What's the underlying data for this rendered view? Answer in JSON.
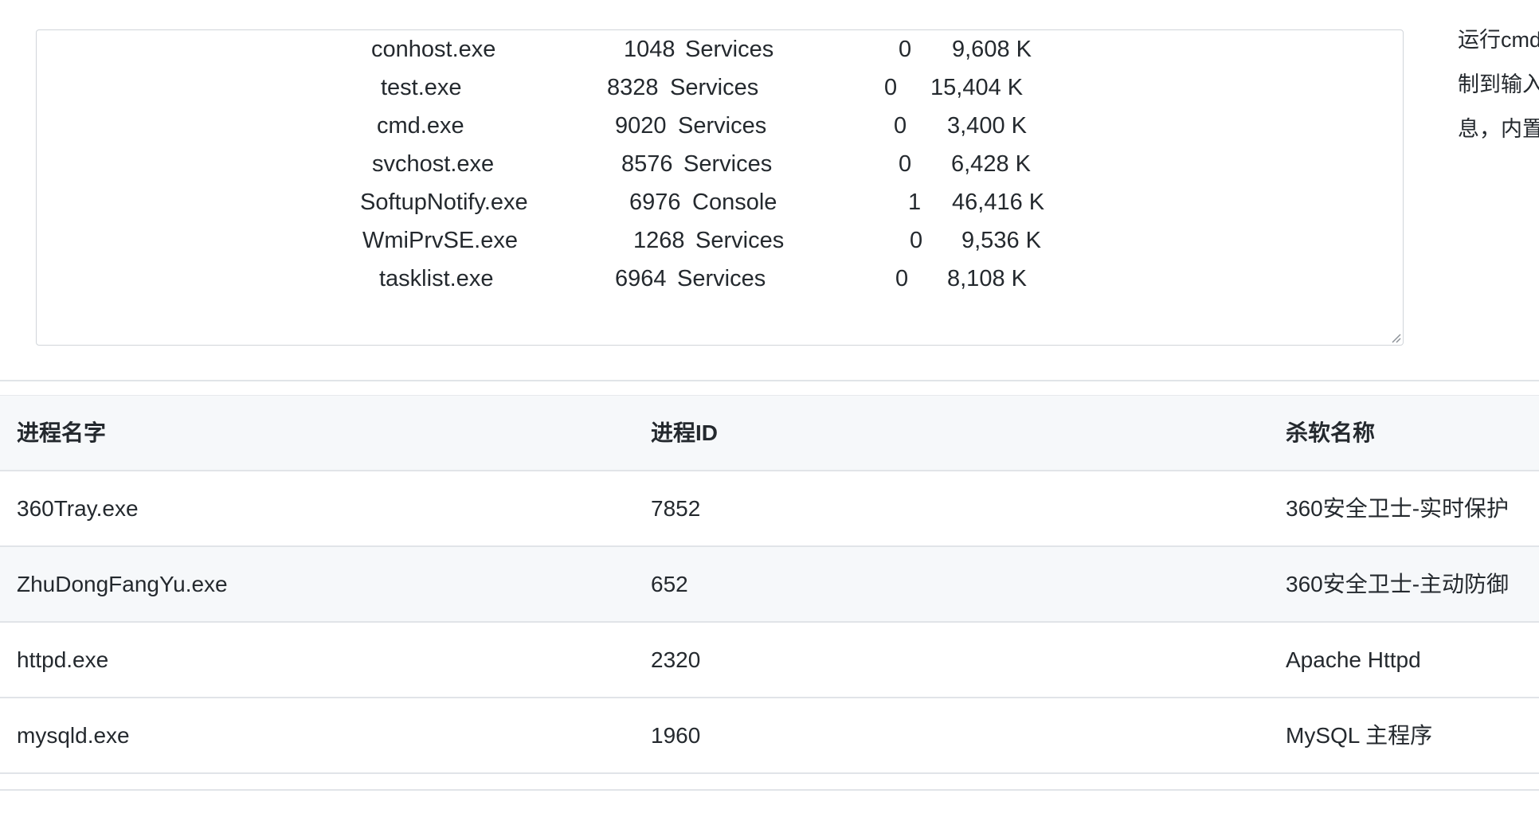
{
  "textarea": {
    "lines": [
      {
        "name": "conhost.exe",
        "pid": "1048",
        "session": "Services",
        "num": "0",
        "mem": "9,608 K"
      },
      {
        "name": "test.exe",
        "pid": "8328",
        "session": "Services",
        "num": "0",
        "mem": "15,404 K"
      },
      {
        "name": "cmd.exe",
        "pid": "9020",
        "session": "Services",
        "num": "0",
        "mem": "3,400 K"
      },
      {
        "name": "svchost.exe",
        "pid": "8576",
        "session": "Services",
        "num": "0",
        "mem": "6,428 K"
      },
      {
        "name": "SoftupNotify.exe",
        "pid": "6976",
        "session": "Console",
        "num": "1",
        "mem": "46,416 K"
      },
      {
        "name": "WmiPrvSE.exe",
        "pid": "1268",
        "session": "Services",
        "num": "0",
        "mem": "9,536 K"
      },
      {
        "name": "tasklist.exe",
        "pid": "6964",
        "session": "Services",
        "num": "0",
        "mem": "8,108 K"
      }
    ]
  },
  "side_note": {
    "lines": [
      "运行cmd",
      "制到输入",
      "息，内置"
    ]
  },
  "table": {
    "headers": [
      "进程名字",
      "进程ID",
      "杀软名称"
    ],
    "rows": [
      [
        "360Tray.exe",
        "7852",
        "360安全卫士-实时保护"
      ],
      [
        "ZhuDongFangYu.exe",
        "652",
        "360安全卫士-主动防御"
      ],
      [
        "httpd.exe",
        "2320",
        "Apache Httpd"
      ],
      [
        "mysqld.exe",
        "1960",
        "MySQL 主程序"
      ]
    ]
  }
}
